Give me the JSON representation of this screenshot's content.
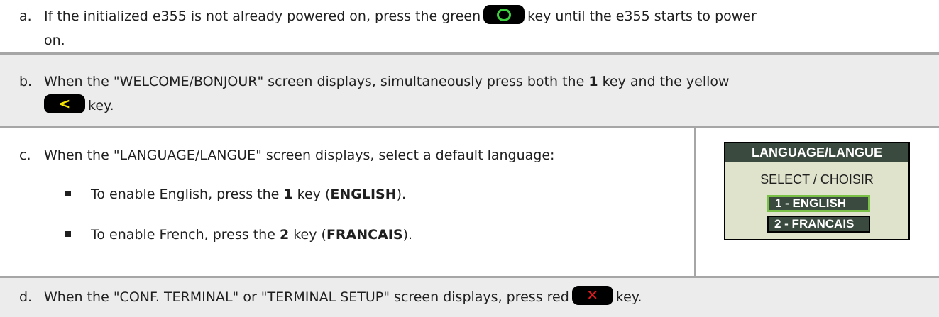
{
  "steps": [
    {
      "letter": "a.",
      "t1": "If the initialized e355 is not already powered on, press the green",
      "t2": "key until the e355 starts to power",
      "t3": "on.",
      "key_icon": "power-key-green-circle"
    },
    {
      "letter": "b.",
      "t1": "When the \"WELCOME/BONJOUR\" screen displays, simultaneously press both the",
      "b1": "1",
      "t2": "key and the yellow",
      "t3": "key.",
      "key_icon": "back-key-yellow-arrow",
      "key_glyph": "<"
    },
    {
      "letter": "c.",
      "text": "When the \"LANGUAGE/LANGUE\" screen displays, select a default language:",
      "bullets": [
        {
          "pre": "To enable English, press the",
          "key": "1",
          "mid": "key (",
          "name": "ENGLISH",
          "post": ")."
        },
        {
          "pre": "To enable French, press the",
          "key": "2",
          "mid": "key (",
          "name": "FRANCAIS",
          "post": ")."
        }
      ],
      "screen": {
        "header": "LANGUAGE/LANGUE",
        "sub": "SELECT / CHOISIR",
        "options": [
          "1 - ENGLISH",
          "2 - FRANCAIS"
        ]
      }
    },
    {
      "letter": "d.",
      "t1": "When the \"CONF. TERMINAL\" or \"TERMINAL SETUP\" screen displays, press red",
      "t2": "key.",
      "key_icon": "cancel-key-red-x",
      "key_glyph": "✕"
    }
  ],
  "colors": {
    "shade": "#ececec",
    "rule": "#a6a6a6",
    "green": "#3ecf3e",
    "yellow": "#f5e400",
    "red": "#e6191e",
    "screen_bg": "#dfe3cc",
    "screen_header": "#3a4a3e"
  }
}
